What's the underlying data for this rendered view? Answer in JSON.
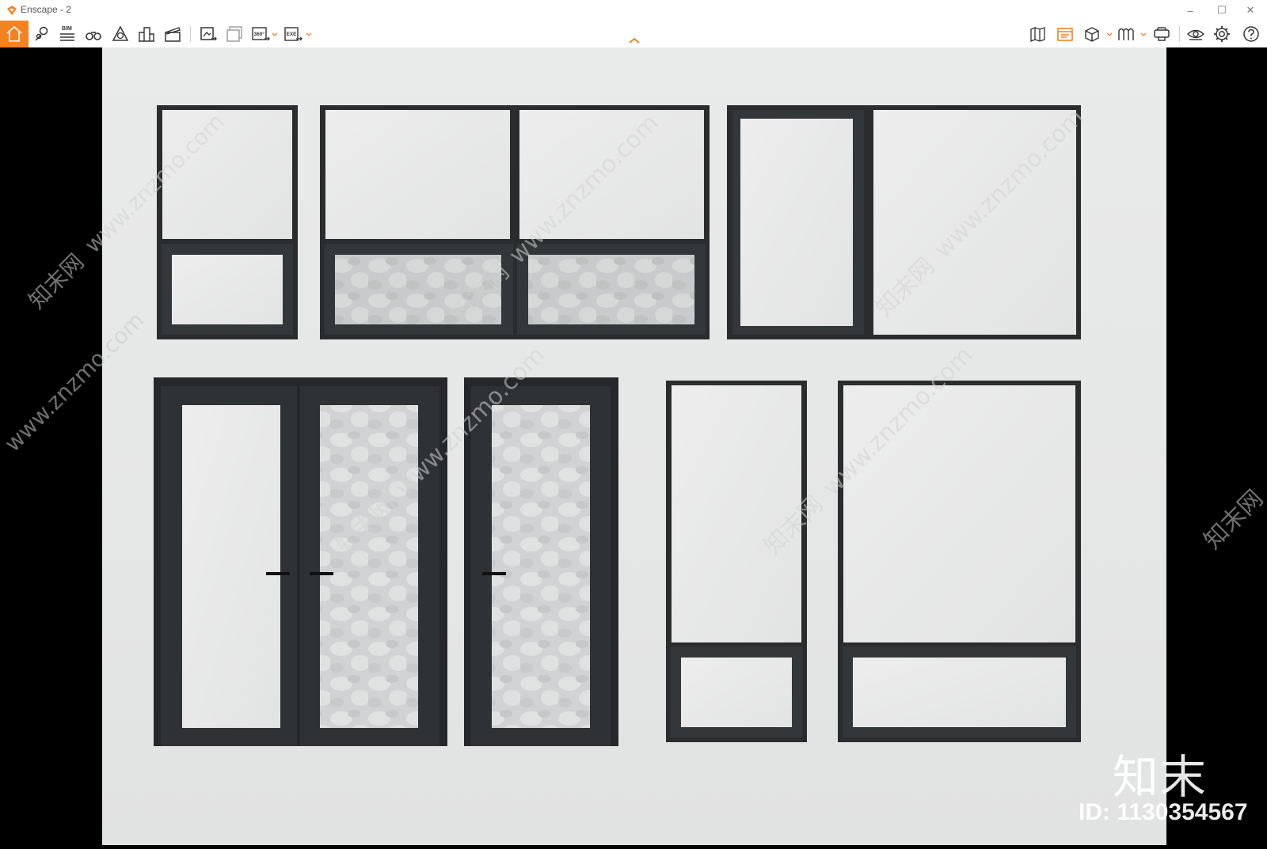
{
  "window": {
    "title": "Enscape - 2",
    "controls": {
      "minimize": "–",
      "maximize": "☐",
      "close": "✕"
    }
  },
  "toolbar": {
    "bim_label": "BIM",
    "pano_label": "360°",
    "exe_label": "EXE",
    "accent_color": "#f58220"
  },
  "watermarks": {
    "url": "www.znzmo.com",
    "site_tag": "知末网",
    "brand": "知末",
    "id": "ID: 1130354567"
  }
}
